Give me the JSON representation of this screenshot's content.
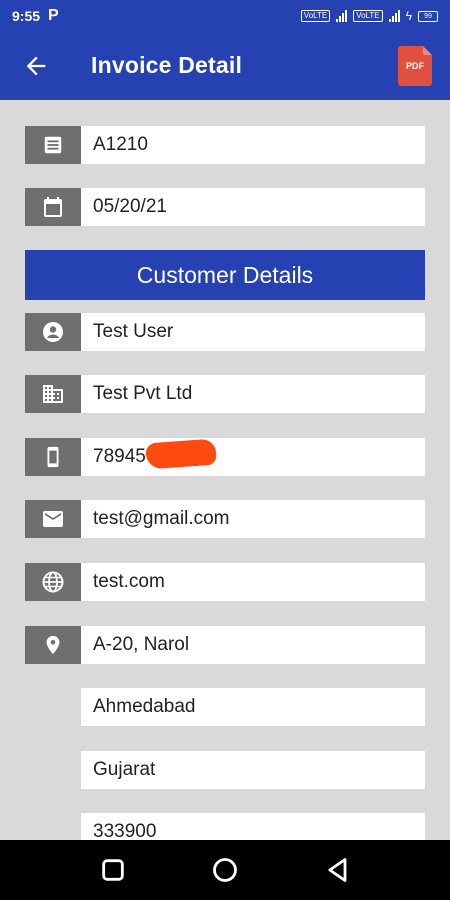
{
  "status": {
    "time": "9:55",
    "carrier_icon": "p-letter",
    "volte1": "VoLTE",
    "volte2": "VoLTE",
    "battery": "99"
  },
  "header": {
    "title": "Invoice Detail",
    "pdf_label": "PDF"
  },
  "invoice": {
    "number": "A1210",
    "date": "05/20/21"
  },
  "section_title": "Customer Details",
  "customer": {
    "name": "Test User",
    "company": "Test Pvt Ltd",
    "phone": "78945",
    "email": "test@gmail.com",
    "website": "test.com",
    "address1": "A-20, Narol",
    "city": "Ahmedabad",
    "state": "Gujarat",
    "zip": "333900"
  },
  "colors": {
    "primary": "#2541b2",
    "icon_bg": "#6f6f6f",
    "background": "#d9d9d9",
    "redaction": "#ff4a10"
  }
}
